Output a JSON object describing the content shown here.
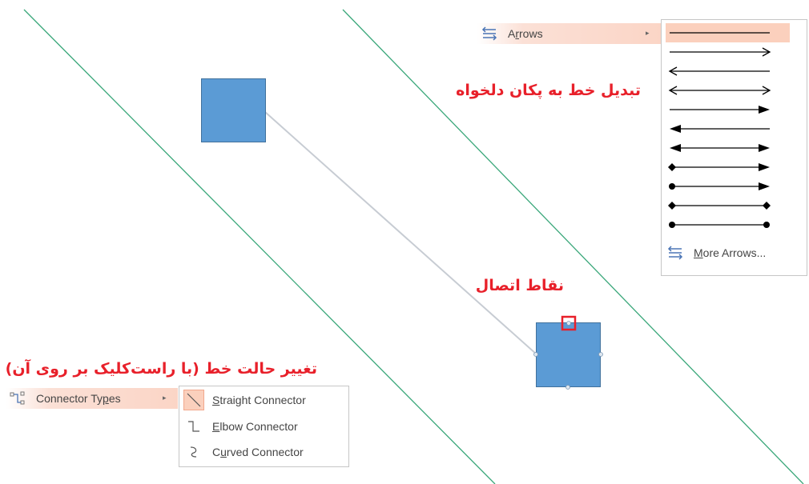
{
  "annotations": {
    "arrow_change": "تبدیل خط به پکان دلخواه",
    "connection_points": "نقاط اتصال",
    "line_mode_change": "تغییر حالت خط (با راست‌کلیک بر روی آن)"
  },
  "arrows_menu": {
    "label_pre": "A",
    "label_accel": "r",
    "label_post": "rows",
    "icon": "arrows-icon",
    "caret": "▸",
    "gallery_styles": [
      "plain-line",
      "open-arrow-right",
      "open-arrow-left",
      "open-arrows-both",
      "solid-arrow-right",
      "solid-arrow-left",
      "solid-arrows-both",
      "diamond-to-arrow",
      "oval-to-arrow",
      "diamond-both",
      "oval-both"
    ],
    "more_pre": "",
    "more_accel": "M",
    "more_post": "ore Arrows..."
  },
  "connector_menu": {
    "label_pre": "Connector Ty",
    "label_accel": "p",
    "label_post": "es",
    "icon": "connector-types-icon",
    "caret": "▸",
    "items": [
      {
        "accel": "S",
        "rest": "traight Connector",
        "icon": "straight-connector-icon",
        "selected": true
      },
      {
        "accel": "E",
        "rest": "lbow Connector",
        "icon": "elbow-connector-icon",
        "selected": false
      },
      {
        "accel": "",
        "rest": "",
        "pre": "C",
        "accel2": "u",
        "post": "rved Connector",
        "icon": "curved-connector-icon",
        "selected": false
      }
    ]
  },
  "colors": {
    "shape_fill": "#5b9bd5",
    "guide_line": "#3aa77a",
    "annotation": "#e8202a",
    "highlight": "#fbd0bd"
  }
}
